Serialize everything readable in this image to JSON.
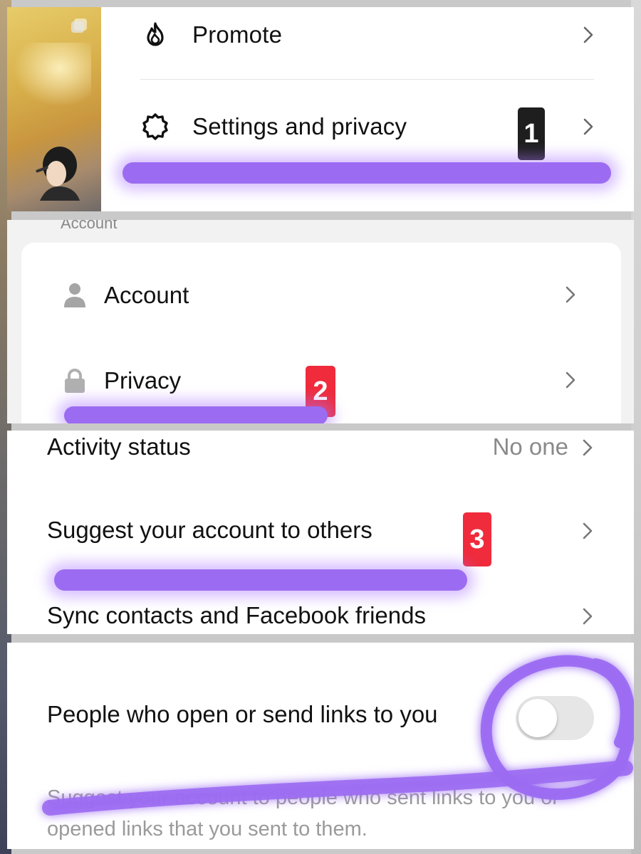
{
  "menu": {
    "promote": {
      "label": "Promote",
      "icon": "flame-icon"
    },
    "settings": {
      "label": "Settings and privacy",
      "icon": "gear-icon"
    }
  },
  "settings_page": {
    "section_label": "Account",
    "items": [
      {
        "label": "Account",
        "icon": "person-icon"
      },
      {
        "label": "Privacy",
        "icon": "lock-icon"
      }
    ]
  },
  "privacy_page": {
    "items": [
      {
        "label": "Activity status",
        "value": "No one"
      },
      {
        "label": "Suggest your account to others",
        "value": ""
      },
      {
        "label": "Sync contacts and Facebook friends",
        "value": ""
      }
    ]
  },
  "suggest_page": {
    "title": "People who open or send links to you",
    "description": "Suggest your account to people who sent links to you or opened links that you sent to them.",
    "toggle_on": false
  },
  "annotations": {
    "step1": "1",
    "step2": "2",
    "step3": "3",
    "highlight_color": "#9b6cf2",
    "badge_dark": "#1e1e1e",
    "badge_red": "#ef2b3c"
  }
}
